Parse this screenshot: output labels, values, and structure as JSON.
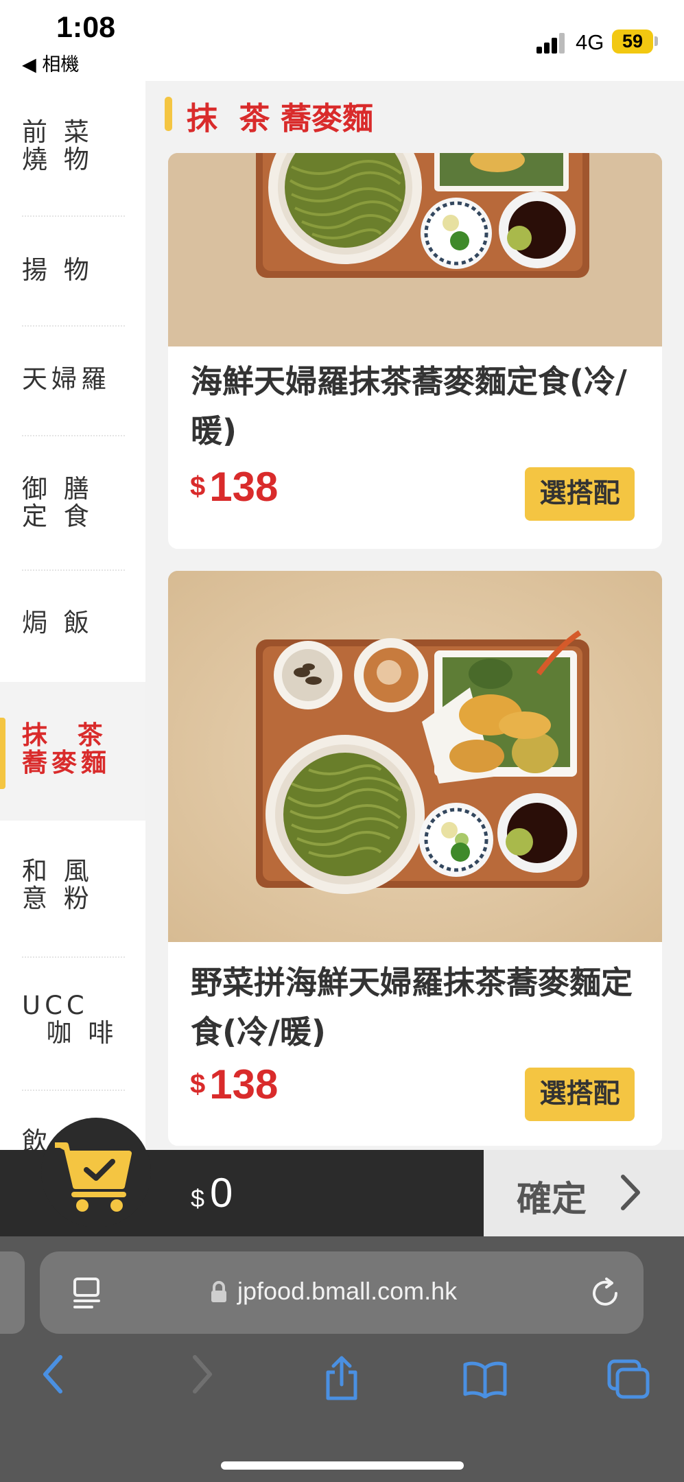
{
  "status_bar": {
    "time": "1:08",
    "back_app": "◀ 相機",
    "network": "4G",
    "battery": "59"
  },
  "sidebar": {
    "items": [
      {
        "label": "前 菜\n燒 物",
        "active": false
      },
      {
        "label": "揚 物",
        "active": false
      },
      {
        "label": "天婦羅",
        "active": false
      },
      {
        "label": "御 膳\n定 食",
        "active": false
      },
      {
        "label": "焗 飯",
        "active": false
      },
      {
        "label": "抹  茶\n蕎麥麵",
        "active": true
      },
      {
        "label": "和 風\n意 粉",
        "active": false
      },
      {
        "label": "UCC\n  咖 啡",
        "active": false
      },
      {
        "label": "飲",
        "active": false
      }
    ]
  },
  "section": {
    "title": "抹  茶 蕎麥麵"
  },
  "items": [
    {
      "name": "海鮮天婦羅抹茶蕎麥麵定食(冷/暖)",
      "currency": "$",
      "price": "138",
      "button": "選搭配"
    },
    {
      "name": "野菜拼海鮮天婦羅抹茶蕎麥麵定食(冷/暖)",
      "currency": "$",
      "price": "138",
      "button": "選搭配"
    }
  ],
  "cart": {
    "currency": "$",
    "total": "0",
    "confirm_label": "確定"
  },
  "browser": {
    "url": "jpfood.bmall.com.hk"
  },
  "icons": {
    "cart": "shopping-cart-check-icon",
    "lock": "lock-icon",
    "reader": "reader-mode-icon",
    "reload": "reload-icon",
    "back": "back-arrow-icon",
    "forward": "forward-arrow-icon",
    "share": "share-icon",
    "bookmarks": "bookmarks-icon",
    "tabs": "tabs-icon"
  },
  "colors": {
    "accent_red": "#d92b2b",
    "accent_yellow": "#f4c542",
    "cart_bar": "#2b2b2b"
  }
}
